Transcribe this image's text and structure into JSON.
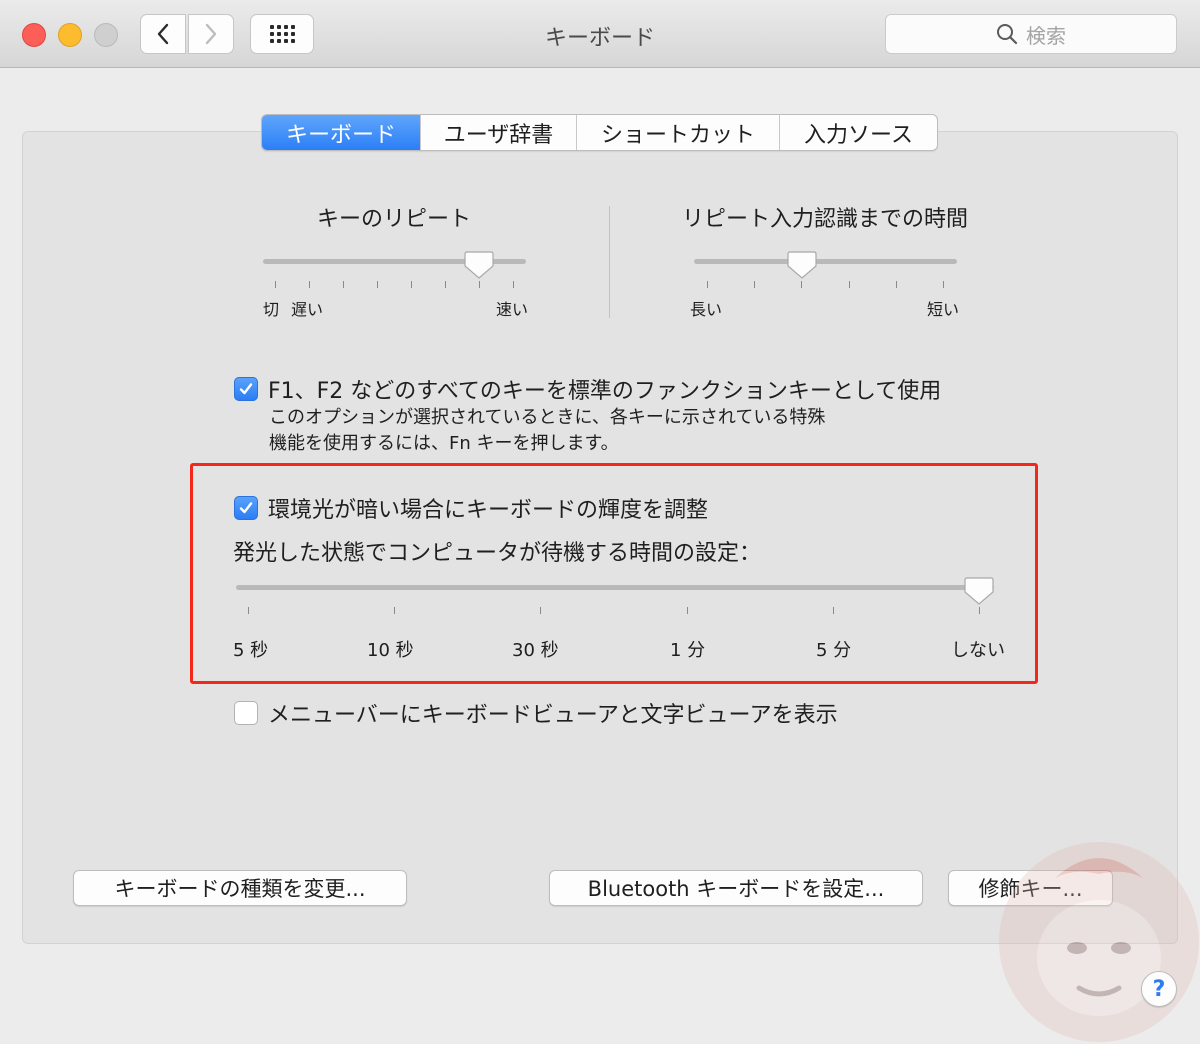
{
  "window": {
    "title": "キーボード",
    "search_placeholder": "検索"
  },
  "tabs": [
    {
      "label": "キーボード",
      "active": true
    },
    {
      "label": "ユーザ辞書",
      "active": false
    },
    {
      "label": "ショートカット",
      "active": false
    },
    {
      "label": "入力ソース",
      "active": false
    }
  ],
  "key_repeat": {
    "title": "キーのリピート",
    "labels": {
      "off": "切",
      "slow": "遅い",
      "fast": "速い"
    },
    "value_fraction": 0.82
  },
  "delay_until_repeat": {
    "title": "リピート入力認識までの時間",
    "labels": {
      "long": "長い",
      "short": "短い"
    },
    "value_fraction": 0.41
  },
  "function_keys": {
    "checked": true,
    "label": "F1、F2 などのすべてのキーを標準のファンクションキーとして使用",
    "description_line1": "このオプションが選択されているときに、各キーに示されている特殊",
    "description_line2": "機能を使用するには、Fn キーを押します。"
  },
  "backlight": {
    "checked": true,
    "label": "環境光が暗い場合にキーボードの輝度を調整",
    "timeout_label": "発光した状態でコンピュータが待機する時間の設定：",
    "timeout_ticks": [
      "5 秒",
      "10 秒",
      "30 秒",
      "1 分",
      "5 分",
      "しない"
    ],
    "timeout_value": "しない"
  },
  "show_viewer": {
    "checked": false,
    "label": "メニューバーにキーボードビューアと文字ビューアを表示"
  },
  "buttons": {
    "change_type": "キーボードの種類を変更...",
    "bluetooth": "Bluetooth キーボードを設定...",
    "modifier": "修飾キー...",
    "help": "?"
  },
  "colors": {
    "accent": "#2b7ff6",
    "highlight": "#f2281b"
  }
}
